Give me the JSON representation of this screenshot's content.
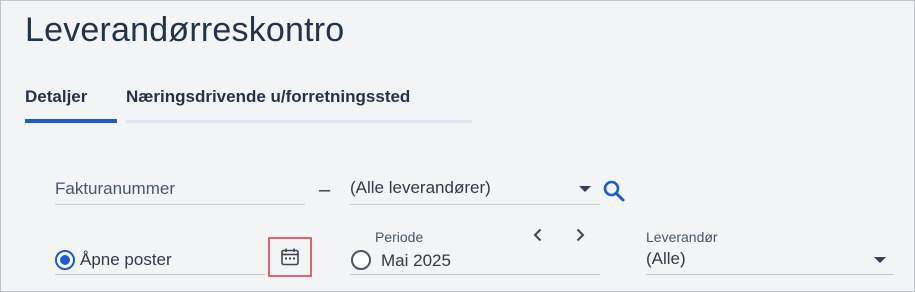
{
  "page": {
    "title": "Leverandørreskontro"
  },
  "tabs": [
    {
      "label": "Detaljer",
      "active": true
    },
    {
      "label": "Næringsdrivende u/forretningssted",
      "active": false
    }
  ],
  "filters": {
    "invoice_number": {
      "placeholder": "Fakturanummer",
      "value": ""
    },
    "range_separator": "–",
    "supplier_select": {
      "value": "(Alle leverandører)",
      "icon": "chevron-down-icon"
    },
    "search_icon": "search-icon",
    "open_items": {
      "label": "Åpne poster",
      "selected": true,
      "icon": "calendar-icon"
    },
    "period": {
      "label": "Periode",
      "value": "Mai 2025",
      "selected": false,
      "prev_icon": "chevron-left-icon",
      "next_icon": "chevron-right-icon"
    },
    "supplier": {
      "label": "Leverandør",
      "value": "(Alle)",
      "icon": "chevron-down-icon"
    }
  },
  "colors": {
    "accent": "#1a5ccf",
    "highlight_border": "#e0646f",
    "text": "#243447"
  }
}
